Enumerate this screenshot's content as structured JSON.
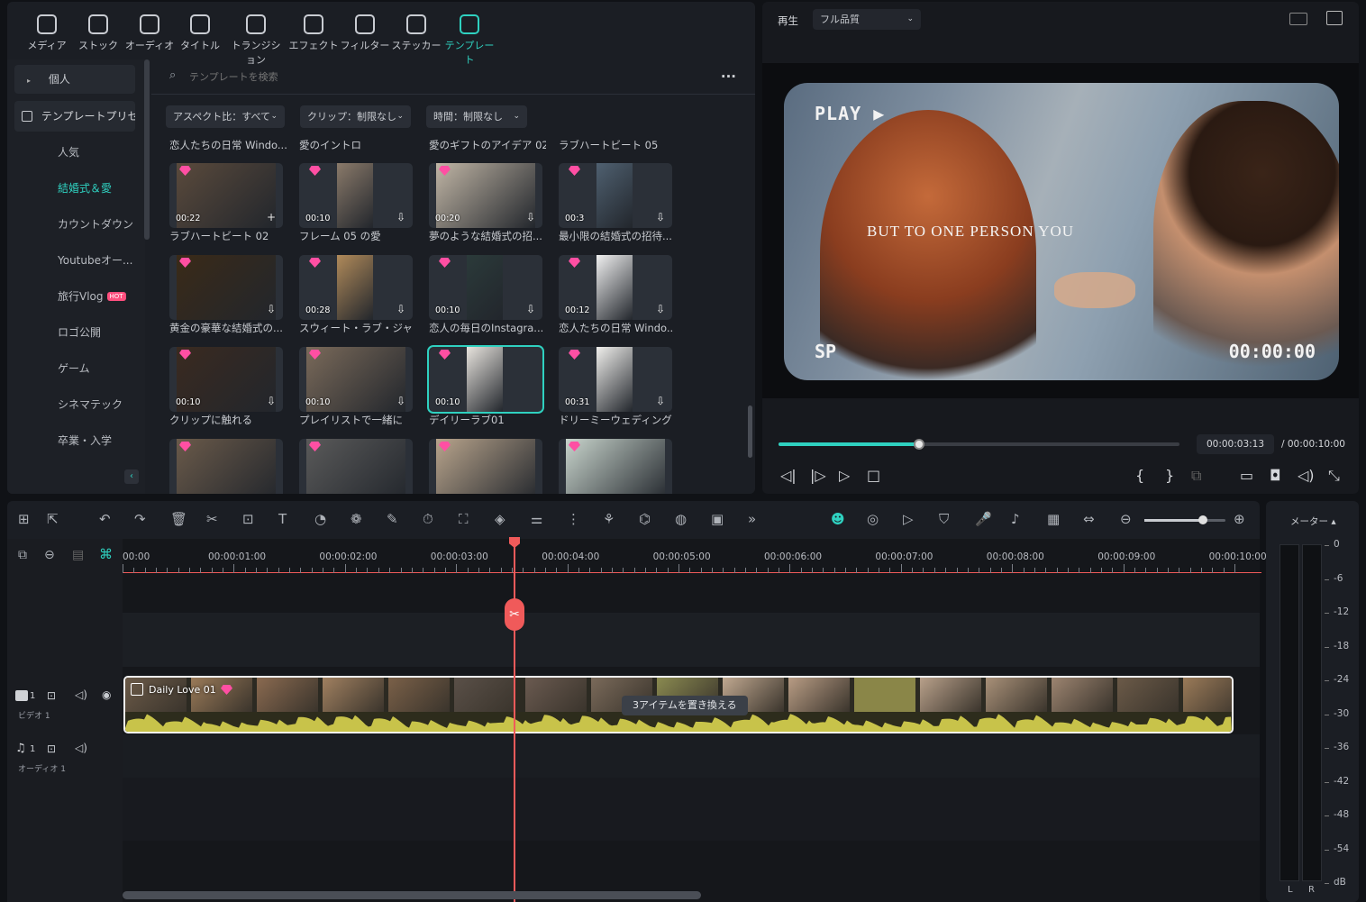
{
  "toolbar": {
    "items": [
      {
        "label": "メディア",
        "icon": "media-icon"
      },
      {
        "label": "ストック",
        "icon": "stock-icon"
      },
      {
        "label": "オーディオ",
        "icon": "audio-icon"
      },
      {
        "label": "タイトル",
        "icon": "title-icon"
      },
      {
        "label": "トランジション",
        "icon": "transition-icon"
      },
      {
        "label": "エフェクト",
        "icon": "effect-icon"
      },
      {
        "label": "フィルター",
        "icon": "filter-icon"
      },
      {
        "label": "ステッカー",
        "icon": "sticker-icon"
      },
      {
        "label": "テンプレート",
        "icon": "template-icon"
      }
    ],
    "active": "テンプレート"
  },
  "sidebar": {
    "personal": "個人",
    "presets": "テンプレートプリセ...",
    "items": [
      "人気",
      "結婚式＆愛",
      "カウントダウン",
      "Youtubeオー...",
      "旅行Vlog",
      "ロゴ公開",
      "ゲーム",
      "シネマテック",
      "卒業・入学"
    ],
    "hot_badge": "HOT",
    "active": "結婚式＆愛"
  },
  "search": {
    "placeholder": "テンプレートを検索",
    "more": "..."
  },
  "filters": [
    "アスペクト比：すべて",
    "クリップ：制限なし",
    "時間：制限なし"
  ],
  "templates": [
    {
      "title": "恋人たちの日常 Windo...",
      "duration": "",
      "bottom": "ラブハートビート 02"
    },
    {
      "title": "愛のイントロ",
      "duration": "00:22"
    },
    {
      "title": "愛のギフトのアイデア 02",
      "duration": "00:10"
    },
    {
      "title": "ラブハートビート 05",
      "duration": "00:20"
    }
  ],
  "grid": {
    "rows": [
      {
        "cells": [
          {
            "caption": "恋人たちの日常 Windo...",
            "duration": "00:22",
            "action": "+"
          },
          {
            "caption": "愛のイントロ",
            "duration": "00:10",
            "action": "⇩"
          },
          {
            "caption": "愛のギフトのアイデア 02",
            "duration": "00:20",
            "action": "⇩"
          },
          {
            "caption": "ラブハートビート 05",
            "duration": "00:3",
            "action": "⇩"
          }
        ]
      },
      {
        "cells": [
          {
            "caption": "ラブハートビート 02",
            "duration": "",
            "action": "⇩"
          },
          {
            "caption": "フレーム 05 の愛",
            "duration": "00:28",
            "action": "⇩"
          },
          {
            "caption": "夢のような結婚式の招...",
            "duration": "00:10",
            "action": "⇩"
          },
          {
            "caption": "最小限の結婚式の招待...",
            "duration": "00:12",
            "action": "⇩"
          }
        ]
      },
      {
        "cells": [
          {
            "caption": "黄金の豪華な結婚式の...",
            "duration": "00:10",
            "action": "⇩"
          },
          {
            "caption": "スウィート・ラブ・ジャーニー",
            "duration": "00:10",
            "action": "⇩"
          },
          {
            "caption": "恋人の毎日のInstagra...",
            "duration": "00:10",
            "action": ""
          },
          {
            "caption": "恋人たちの日常 Windo...",
            "duration": "00:31",
            "action": "⇩"
          }
        ]
      },
      {
        "cells": [
          {
            "caption": "クリップに触れる",
            "duration": "",
            "action": ""
          },
          {
            "caption": "プレイリストで一緒に",
            "duration": "",
            "action": ""
          },
          {
            "caption": "デイリーラブ01",
            "duration": "",
            "action": ""
          },
          {
            "caption": "ドリーミーウェディングメモリ...",
            "duration": "",
            "action": ""
          }
        ]
      }
    ]
  },
  "preview": {
    "play_label": "再生",
    "quality": "フル品質",
    "overlay_play": "PLAY ▶",
    "overlay_caption": "BUT TO ONE PERSON YOU",
    "overlay_sp": "SP",
    "overlay_time": "00:00:00",
    "current_time": "00:00:03:13",
    "total_time": "/ 00:00:10:00",
    "progress_fraction": 0.35
  },
  "timeline": {
    "ruler": [
      "00:00",
      "00:00:01:00",
      "00:00:02:00",
      "00:00:03:00",
      "00:00:04:00",
      "00:00:05:00",
      "00:00:06:00",
      "00:00:07:00",
      "00:00:08:00",
      "00:00:09:00",
      "00:00:10:00"
    ],
    "video_track_label": "ビデオ 1",
    "video_track_num": "1",
    "audio_track_label": "オーディオ 1",
    "audio_track_num": "1",
    "clip_name": "Daily Love 01",
    "replace_tooltip": "3アイテムを置き換える",
    "zoom_fraction": 0.72
  },
  "meter": {
    "title": "メーター",
    "levels": [
      "0",
      "-6",
      "-12",
      "-18",
      "-24",
      "-30",
      "-36",
      "-42",
      "-48",
      "-54",
      "dB"
    ],
    "left": "L",
    "right": "R"
  },
  "colors": {
    "accent": "#2fd1c0",
    "playhead": "#f05a5a",
    "clip_border": "#f5f5f5",
    "waveform": "#c8c34a"
  }
}
